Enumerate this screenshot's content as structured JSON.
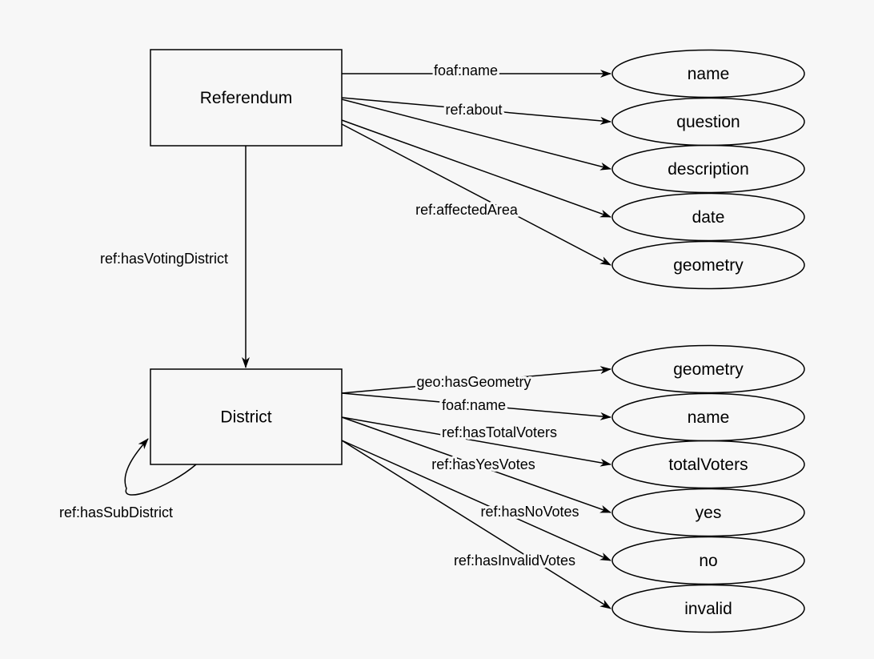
{
  "colors": {
    "background": "#f7f7f7",
    "stroke": "#000000"
  },
  "classes": [
    {
      "id": "referendum",
      "label": "Referendum"
    },
    {
      "id": "district",
      "label": "District"
    }
  ],
  "properties": [
    {
      "id": "ref-name",
      "label": "name"
    },
    {
      "id": "ref-question",
      "label": "question"
    },
    {
      "id": "ref-description",
      "label": "description"
    },
    {
      "id": "ref-date",
      "label": "date"
    },
    {
      "id": "ref-geometry",
      "label": "geometry"
    },
    {
      "id": "dis-geometry",
      "label": "geometry"
    },
    {
      "id": "dis-name",
      "label": "name"
    },
    {
      "id": "dis-totalVoters",
      "label": "totalVoters"
    },
    {
      "id": "dis-yes",
      "label": "yes"
    },
    {
      "id": "dis-no",
      "label": "no"
    },
    {
      "id": "dis-invalid",
      "label": "invalid"
    }
  ],
  "edges": [
    {
      "from": "referendum",
      "to": "ref-name",
      "label": "foaf:name"
    },
    {
      "from": "referendum",
      "to": "ref-question",
      "label": "ref:about"
    },
    {
      "from": "referendum",
      "to": "ref-description",
      "label": ""
    },
    {
      "from": "referendum",
      "to": "ref-date",
      "label": ""
    },
    {
      "from": "referendum",
      "to": "ref-geometry",
      "label": "ref:affectedArea"
    },
    {
      "from": "referendum",
      "to": "district",
      "label": "ref:hasVotingDistrict"
    },
    {
      "from": "district",
      "to": "dis-geometry",
      "label": "geo:hasGeometry"
    },
    {
      "from": "district",
      "to": "dis-name",
      "label": "foaf:name"
    },
    {
      "from": "district",
      "to": "dis-totalVoters",
      "label": "ref:hasTotalVoters"
    },
    {
      "from": "district",
      "to": "dis-yes",
      "label": "ref:hasYesVotes"
    },
    {
      "from": "district",
      "to": "dis-no",
      "label": "ref:hasNoVotes"
    },
    {
      "from": "district",
      "to": "dis-invalid",
      "label": "ref:hasInvalidVotes"
    },
    {
      "from": "district",
      "to": "district",
      "label": "ref:hasSubDistrict"
    }
  ]
}
